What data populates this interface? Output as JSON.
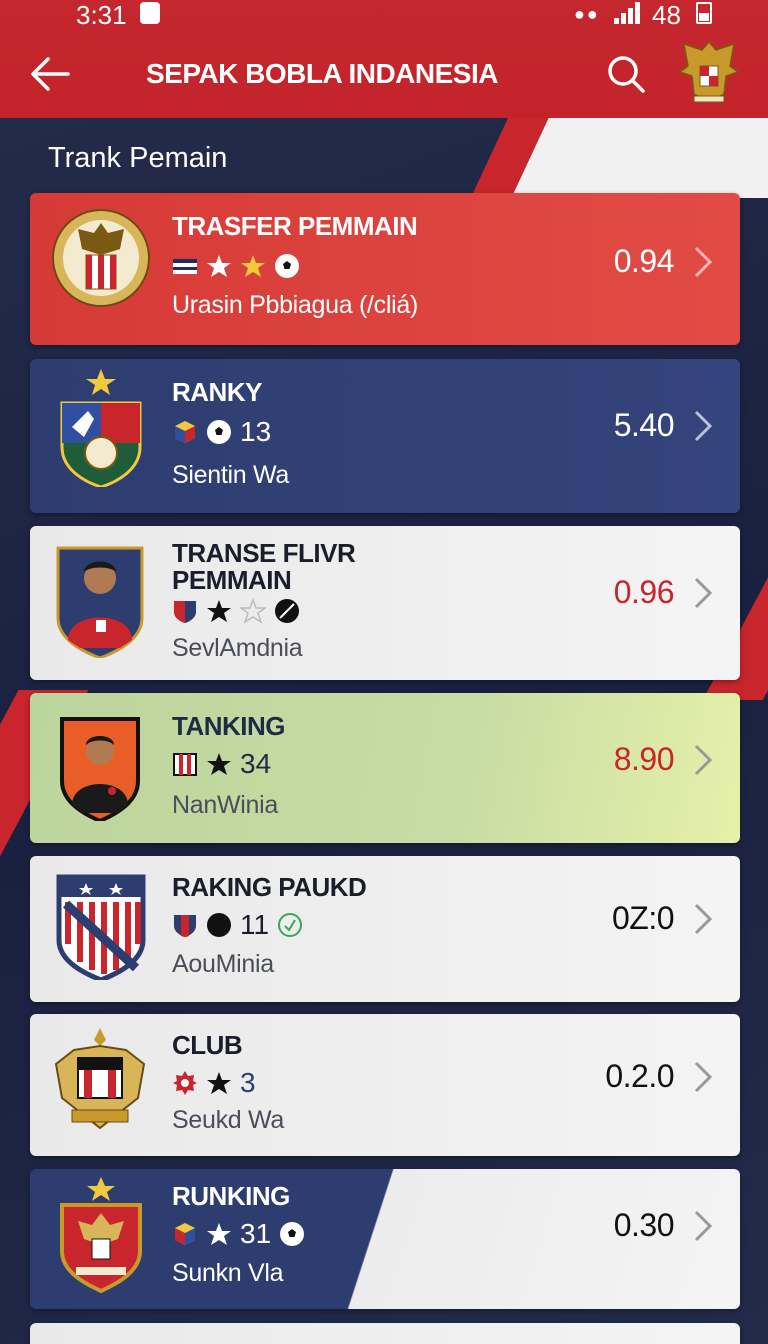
{
  "status_bar": {
    "time": "3:31",
    "battery": "48"
  },
  "app_bar": {
    "title": "SEPAK BOBLA INDANESIA"
  },
  "section": {
    "title": "Trank Pemain"
  },
  "colors": {
    "header_red": "#c5272e",
    "navy": "#2e3d70",
    "score_red": "#c8252d"
  },
  "cards": [
    {
      "title": "TRASFER PEMMAIN",
      "meta_number": "",
      "subtitle": "Urasin Pbbiagua (/cliá)",
      "score": "0.94",
      "icons": [
        "flag-icon",
        "star-icon",
        "star-icon",
        "soccer-ball-icon"
      ]
    },
    {
      "title": "RANKY",
      "meta_number": "13",
      "subtitle": "Sientin Wa",
      "score": "5.40",
      "icons": [
        "cube-icon",
        "soccer-ball-icon"
      ]
    },
    {
      "title": "TRANSE FLIVR PEMMAIN",
      "meta_number": "",
      "subtitle": "SevlAmdnia",
      "score": "0.96",
      "icons": [
        "shield-icon",
        "star-icon",
        "star-outline-icon",
        "ball-icon"
      ]
    },
    {
      "title": "TANKING",
      "meta_number": "34",
      "subtitle": "NanWinia",
      "score": "8.90",
      "icons": [
        "club-badge-icon",
        "star-icon"
      ]
    },
    {
      "title": "RAKING PAUKD",
      "meta_number": "11",
      "subtitle": "AouMinia",
      "score": "0Z:0",
      "icons": [
        "shield-icon",
        "dot-icon",
        "green-ring-icon"
      ]
    },
    {
      "title": "CLUB",
      "meta_number": "3",
      "subtitle": "Seukd Wa",
      "score": "0.2.0",
      "icons": [
        "gear-badge-icon",
        "star-icon"
      ]
    },
    {
      "title": "RUNKING",
      "meta_number": "31",
      "subtitle": "Sunkn Vla",
      "score": "0.30",
      "icons": [
        "cube-icon",
        "star-icon",
        "soccer-ball-icon"
      ]
    }
  ]
}
